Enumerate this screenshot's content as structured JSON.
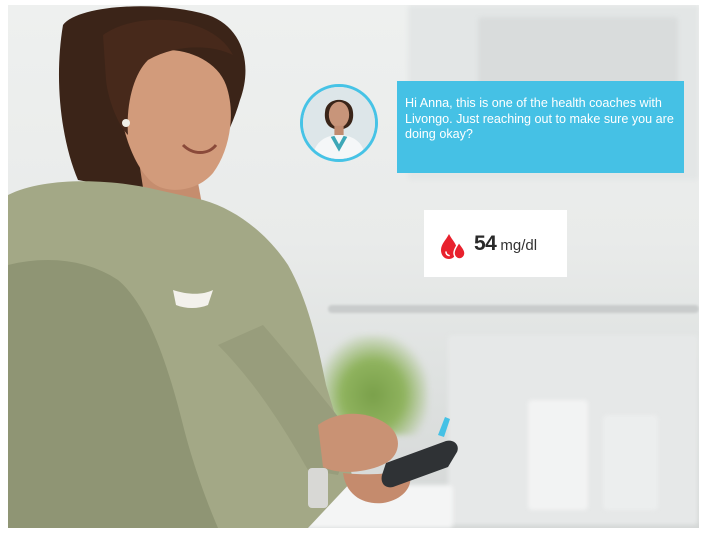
{
  "chat": {
    "avatar_icon": "coach-avatar-icon",
    "message": "Hi Anna, this is one of the health coaches with Livongo. Just reaching out to make sure you are doing okay?",
    "bubble_color": "#45c1e5"
  },
  "reading": {
    "icon": "blood-drop-icon",
    "value": "54",
    "unit": "mg/dl",
    "icon_color": "#e8212d"
  }
}
